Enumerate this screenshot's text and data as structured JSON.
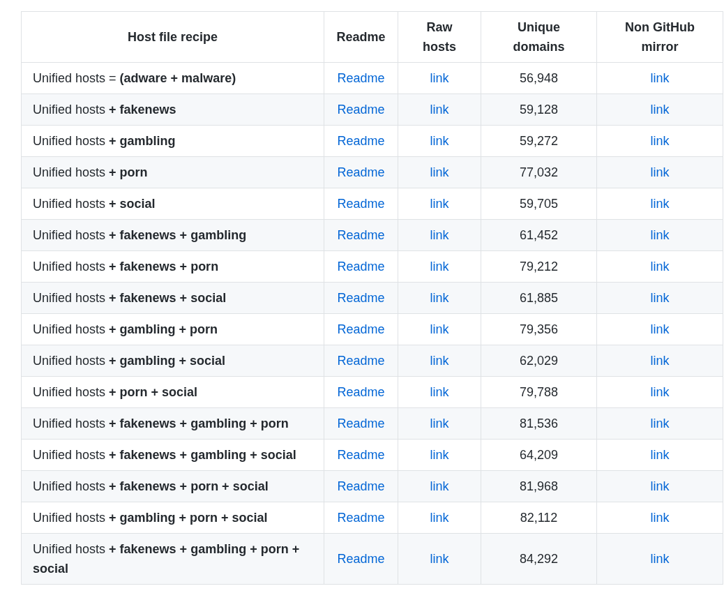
{
  "table": {
    "columns": [
      "Host file recipe",
      "Readme",
      "Raw hosts",
      "Unique domains",
      "Non GitHub mirror"
    ],
    "rows": [
      {
        "recipe": "Unified hosts = **(adware + malware)**",
        "readme": "Readme",
        "raw_hosts": "link",
        "unique_domains": "56,948",
        "mirror": "link"
      },
      {
        "recipe": "Unified hosts **+ fakenews**",
        "readme": "Readme",
        "raw_hosts": "link",
        "unique_domains": "59,128",
        "mirror": "link"
      },
      {
        "recipe": "Unified hosts **+ gambling**",
        "readme": "Readme",
        "raw_hosts": "link",
        "unique_domains": "59,272",
        "mirror": "link"
      },
      {
        "recipe": "Unified hosts **+ porn**",
        "readme": "Readme",
        "raw_hosts": "link",
        "unique_domains": "77,032",
        "mirror": "link"
      },
      {
        "recipe": "Unified hosts **+ social**",
        "readme": "Readme",
        "raw_hosts": "link",
        "unique_domains": "59,705",
        "mirror": "link"
      },
      {
        "recipe": "Unified hosts **+ fakenews + gambling**",
        "readme": "Readme",
        "raw_hosts": "link",
        "unique_domains": "61,452",
        "mirror": "link"
      },
      {
        "recipe": "Unified hosts **+ fakenews + porn**",
        "readme": "Readme",
        "raw_hosts": "link",
        "unique_domains": "79,212",
        "mirror": "link"
      },
      {
        "recipe": "Unified hosts **+ fakenews + social**",
        "readme": "Readme",
        "raw_hosts": "link",
        "unique_domains": "61,885",
        "mirror": "link"
      },
      {
        "recipe": "Unified hosts **+ gambling + porn**",
        "readme": "Readme",
        "raw_hosts": "link",
        "unique_domains": "79,356",
        "mirror": "link"
      },
      {
        "recipe": "Unified hosts **+ gambling + social**",
        "readme": "Readme",
        "raw_hosts": "link",
        "unique_domains": "62,029",
        "mirror": "link"
      },
      {
        "recipe": "Unified hosts **+ porn + social**",
        "readme": "Readme",
        "raw_hosts": "link",
        "unique_domains": "79,788",
        "mirror": "link"
      },
      {
        "recipe": "Unified hosts **+ fakenews + gambling + porn**",
        "readme": "Readme",
        "raw_hosts": "link",
        "unique_domains": "81,536",
        "mirror": "link"
      },
      {
        "recipe": "Unified hosts **+ fakenews + gambling + social**",
        "readme": "Readme",
        "raw_hosts": "link",
        "unique_domains": "64,209",
        "mirror": "link"
      },
      {
        "recipe": "Unified hosts **+ fakenews + porn + social**",
        "readme": "Readme",
        "raw_hosts": "link",
        "unique_domains": "81,968",
        "mirror": "link"
      },
      {
        "recipe": "Unified hosts **+ gambling + porn + social**",
        "readme": "Readme",
        "raw_hosts": "link",
        "unique_domains": "82,112",
        "mirror": "link"
      },
      {
        "recipe": "Unified hosts **+ fakenews + gambling + porn + social**",
        "readme": "Readme",
        "raw_hosts": "link",
        "unique_domains": "84,292",
        "mirror": "link"
      }
    ]
  }
}
